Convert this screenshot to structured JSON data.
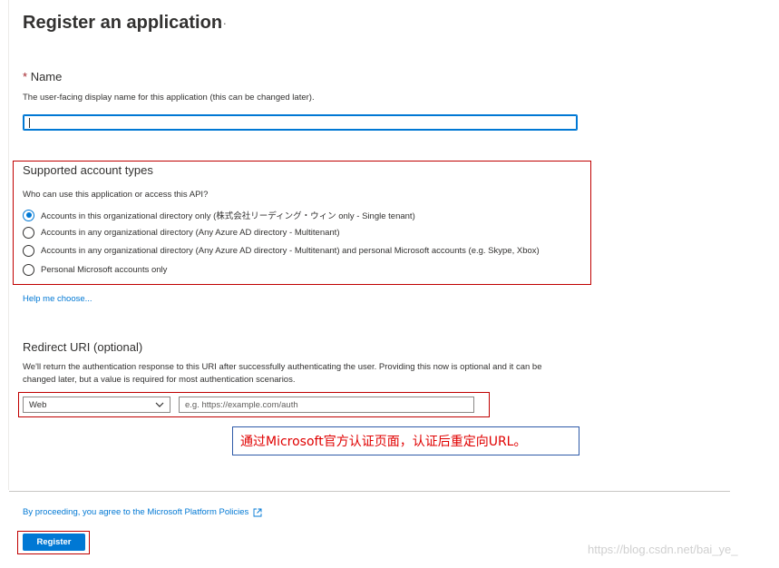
{
  "header": {
    "title": "Register an application",
    "more_label": "···"
  },
  "name_section": {
    "required_marker": "*",
    "label": "Name",
    "description": "The user-facing display name for this application (this can be changed later).",
    "value": ""
  },
  "account_types": {
    "heading": "Supported account types",
    "question": "Who can use this application or access this API?",
    "options": [
      {
        "label": "Accounts in this organizational directory only (株式会社リーディング・ウィン only - Single tenant)",
        "checked": true
      },
      {
        "label": "Accounts in any organizational directory (Any Azure AD directory - Multitenant)",
        "checked": false
      },
      {
        "label": "Accounts in any organizational directory (Any Azure AD directory - Multitenant) and personal Microsoft accounts (e.g. Skype, Xbox)",
        "checked": false
      },
      {
        "label": "Personal Microsoft accounts only",
        "checked": false
      }
    ],
    "help_link": "Help me choose..."
  },
  "redirect": {
    "heading": "Redirect URI (optional)",
    "description_line1": "We'll return the authentication response to this URI after successfully authenticating the user. Providing this now is optional and it can be",
    "description_line2": "changed later, but a value is required for most authentication scenarios.",
    "platform_selected": "Web",
    "uri_placeholder": "e.g. https://example.com/auth",
    "uri_value": ""
  },
  "annotation": {
    "text": "通过Microsoft官方认证页面，认证后重定向URL。"
  },
  "footer": {
    "policy_text": "By proceeding, you agree to the Microsoft Platform Policies",
    "register_label": "Register"
  },
  "watermark": "https://blog.csdn.net/bai_ye_",
  "colors": {
    "accent": "#0078d4",
    "highlight_box": "#c00000",
    "annotation_text": "#e00000",
    "annotation_border": "#2e5aa8"
  }
}
